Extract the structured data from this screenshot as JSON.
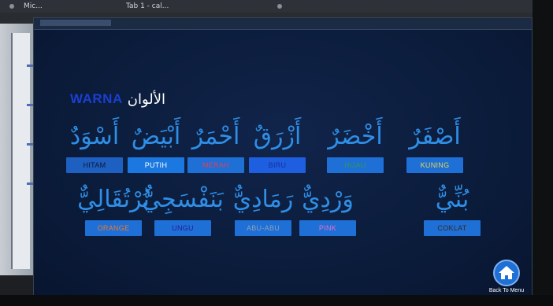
{
  "taskbar": {
    "left_text": "Mic...",
    "middle_text": "Tab 1 - cal..."
  },
  "app": {
    "title_latin": "WARNA",
    "title_arabic": "الألوان"
  },
  "colors_row1": [
    {
      "arabic": "أَسْوَدٌ",
      "label": "HITAM",
      "btn_bg": "#1e5fc2",
      "btn_fg": "#0d1a33"
    },
    {
      "arabic": "أَبْيَضٌ",
      "label": "PUTIH",
      "btn_bg": "#1b78e0",
      "btn_fg": "#ffffff"
    },
    {
      "arabic": "أَحْمَرٌ",
      "label": "MERAH",
      "btn_bg": "#1e6fd6",
      "btn_fg": "#e0405a"
    },
    {
      "arabic": "أَزْرَقٌ",
      "label": "BIRU",
      "btn_bg": "#1d5fe0",
      "btn_fg": "#1a2fa0"
    },
    {
      "arabic": "أَخْضَرٌ",
      "label": "HIJAU",
      "btn_bg": "#1e6fd6",
      "btn_fg": "#2e9a55"
    },
    {
      "arabic": "أَصْفَرٌ",
      "label": "KUNING",
      "btn_bg": "#1e6fd6",
      "btn_fg": "#e8d84a"
    }
  ],
  "colors_row2": [
    {
      "arabic": "بُرْتُقَالِيٌّ",
      "label": "ORANGE",
      "btn_bg": "#1e6fd6",
      "btn_fg": "#f07a2a"
    },
    {
      "arabic": "بَنَفْسَجِيٌّ",
      "label": "UNGU",
      "btn_bg": "#1e6fd6",
      "btn_fg": "#2a1a9a"
    },
    {
      "arabic": "رَمَادِيٌّ",
      "label": "ABU-ABU",
      "btn_bg": "#1e6fd6",
      "btn_fg": "#8aa0b8"
    },
    {
      "arabic": "وَرْدِيٌّ",
      "label": "PINK",
      "btn_bg": "#1e6fd6",
      "btn_fg": "#e870c8"
    },
    {
      "arabic": "بُنِّيٌّ",
      "label": "COKLAT",
      "btn_bg": "#1e6fd6",
      "btn_fg": "#3a2a20"
    }
  ],
  "nav": {
    "home_label": "Back To Menu"
  },
  "theme": {
    "background": "#0b1c3b",
    "arabic_text": "#2f8ee6",
    "title_latin": "#1a3fd0"
  }
}
